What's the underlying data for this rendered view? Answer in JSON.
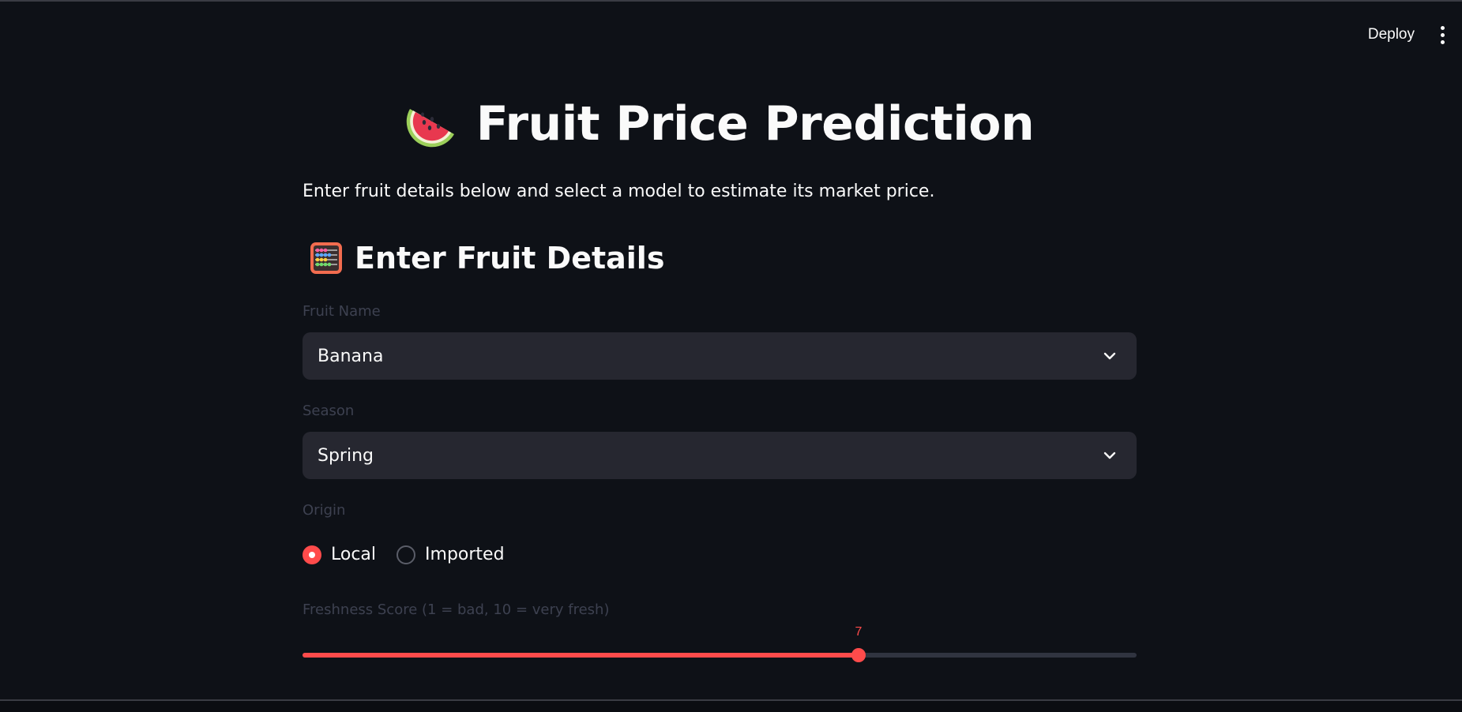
{
  "header": {
    "deploy_label": "Deploy"
  },
  "page": {
    "title": "Fruit Price Prediction",
    "title_icon": "watermelon-icon",
    "subtitle": "Enter fruit details below and select a model to estimate its market price."
  },
  "section": {
    "title": "Enter Fruit Details",
    "icon": "abacus-icon"
  },
  "form": {
    "fruit_name": {
      "label": "Fruit Name",
      "value": "Banana"
    },
    "season": {
      "label": "Season",
      "value": "Spring"
    },
    "origin": {
      "label": "Origin",
      "options": [
        "Local",
        "Imported"
      ],
      "selected": "Local"
    },
    "freshness": {
      "label": "Freshness Score (1 = bad, 10 = very fresh)",
      "min": 1,
      "max": 10,
      "value": 7,
      "value_label": "7"
    }
  },
  "colors": {
    "background": "#0e1117",
    "accent": "#ff4b4b",
    "input_bg": "#262730",
    "label": "#3d4150"
  }
}
